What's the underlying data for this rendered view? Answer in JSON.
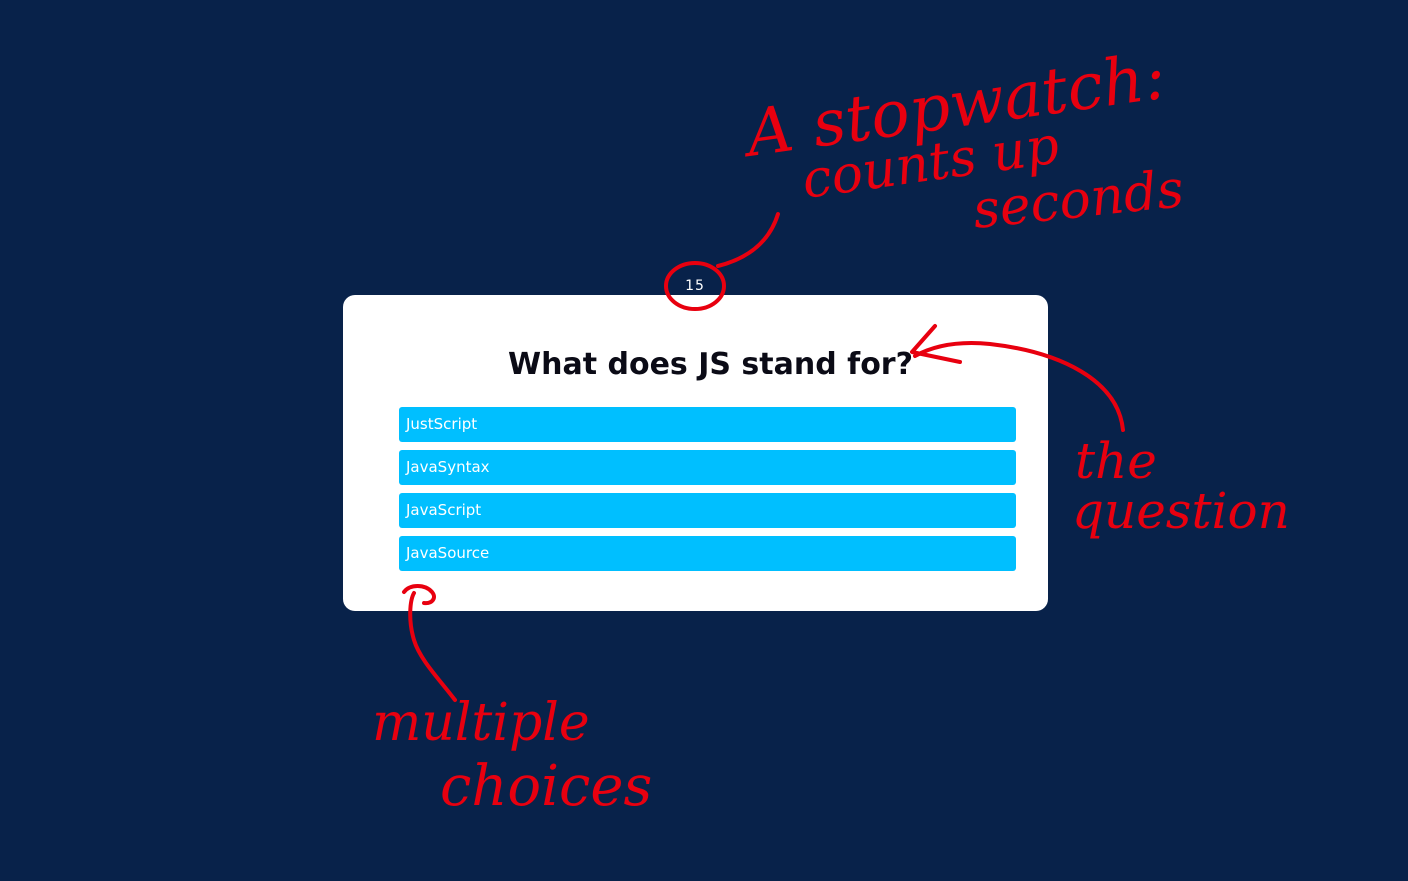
{
  "quiz": {
    "timer_seconds": "15",
    "question": "What does JS stand for?",
    "choices": [
      "JustScript",
      "JavaSyntax",
      "JavaScript",
      "JavaSource"
    ]
  },
  "annotations": {
    "stopwatch_line1": "A stopwatch:",
    "stopwatch_line2": "counts up",
    "stopwatch_line3": "seconds",
    "question_line1": "the",
    "question_line2": "question",
    "choices_line1": "multiple",
    "choices_line2": "choices"
  },
  "colors": {
    "background": "#08224a",
    "card": "#ffffff",
    "choice": "#00bfff",
    "annotation": "#e8000f"
  }
}
